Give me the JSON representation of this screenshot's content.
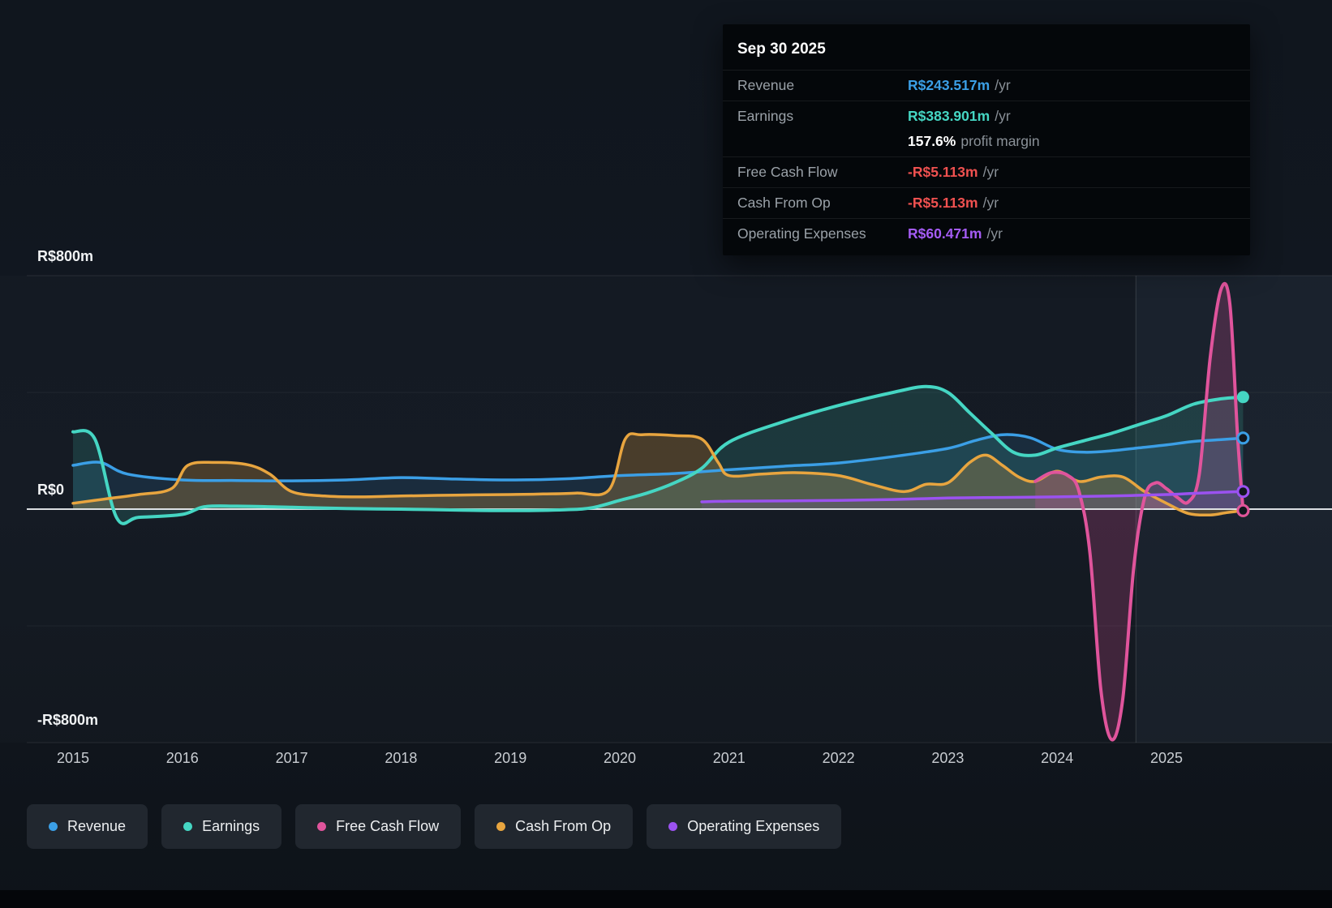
{
  "tooltip": {
    "date": "Sep 30 2025",
    "rows": [
      {
        "label": "Revenue",
        "value": "R$243.517m",
        "suffix": "/yr",
        "color": "#3b9fe6"
      },
      {
        "label": "Earnings",
        "value": "R$383.901m",
        "suffix": "/yr",
        "color": "#45d6c3"
      },
      {
        "label": "Free Cash Flow",
        "value": "-R$5.113m",
        "suffix": "/yr",
        "color": "#f05150"
      },
      {
        "label": "Cash From Op",
        "value": "-R$5.113m",
        "suffix": "/yr",
        "color": "#f05150"
      },
      {
        "label": "Operating Expenses",
        "value": "R$60.471m",
        "suffix": "/yr",
        "color": "#a55cf5"
      }
    ],
    "margin": {
      "value": "157.6%",
      "text": "profit margin"
    }
  },
  "axis": {
    "y_top": "R$800m",
    "y_zero": "R$0",
    "y_bottom": "-R$800m"
  },
  "legend": {
    "items": [
      {
        "label": "Revenue",
        "color": "#3b9fe6"
      },
      {
        "label": "Earnings",
        "color": "#45d6c3"
      },
      {
        "label": "Free Cash Flow",
        "color": "#e0549c"
      },
      {
        "label": "Cash From Op",
        "color": "#e8a53f"
      },
      {
        "label": "Operating Expenses",
        "color": "#9b52f0"
      }
    ]
  },
  "chart_data": {
    "type": "line",
    "x_unit": "year",
    "ylim": [
      -800,
      800
    ],
    "grid": true,
    "legend_position": "bottom",
    "y_tick_labels": [
      "R$800m",
      "R$0",
      "-R$800m"
    ],
    "x_tick_labels": [
      "2015",
      "2016",
      "2017",
      "2018",
      "2019",
      "2020",
      "2021",
      "2022",
      "2023",
      "2024",
      "2025"
    ],
    "highlight_band_start": 2024.72,
    "series": [
      {
        "name": "Revenue",
        "color": "#3b9fe6",
        "fill_opacity": 0.13,
        "width": 3.5,
        "x": [
          2015,
          2015.25,
          2015.5,
          2016,
          2016.5,
          2017,
          2017.5,
          2018,
          2018.5,
          2019,
          2019.5,
          2020,
          2020.5,
          2021,
          2021.5,
          2022,
          2022.5,
          2023,
          2023.25,
          2023.5,
          2023.75,
          2024,
          2024.25,
          2024.5,
          2024.75,
          2025,
          2025.25,
          2025.5,
          2025.7
        ],
        "values": [
          150,
          160,
          120,
          100,
          98,
          97,
          100,
          108,
          103,
          100,
          104,
          115,
          122,
          135,
          147,
          158,
          180,
          208,
          235,
          255,
          245,
          205,
          195,
          200,
          210,
          220,
          232,
          238,
          243.5
        ]
      },
      {
        "name": "Earnings",
        "color": "#45d6c3",
        "fill_opacity": 0.16,
        "width": 4,
        "x": [
          2015,
          2015.2,
          2015.4,
          2015.6,
          2016,
          2016.2,
          2016.5,
          2017,
          2017.5,
          2018,
          2018.5,
          2019,
          2019.5,
          2019.75,
          2020,
          2020.25,
          2020.5,
          2020.75,
          2021,
          2021.5,
          2022,
          2022.5,
          2022.8,
          2023,
          2023.2,
          2023.4,
          2023.6,
          2023.8,
          2024,
          2024.25,
          2024.5,
          2024.75,
          2025,
          2025.25,
          2025.5,
          2025.7
        ],
        "values": [
          265,
          240,
          -30,
          -28,
          -18,
          8,
          10,
          6,
          2,
          0,
          -3,
          -5,
          -2,
          5,
          30,
          55,
          90,
          140,
          230,
          300,
          355,
          400,
          420,
          400,
          330,
          260,
          195,
          185,
          210,
          235,
          260,
          290,
          320,
          360,
          378,
          383.9
        ]
      },
      {
        "name": "Cash From Op",
        "color": "#e8a53f",
        "fill_opacity": 0.25,
        "width": 3.5,
        "x": [
          2015,
          2015.3,
          2015.6,
          2015.9,
          2016.05,
          2016.3,
          2016.6,
          2016.8,
          2017,
          2017.3,
          2017.6,
          2018,
          2018.5,
          2019,
          2019.3,
          2019.6,
          2019.9,
          2020.05,
          2020.2,
          2020.5,
          2020.75,
          2020.9,
          2021,
          2021.3,
          2021.6,
          2022,
          2022.3,
          2022.6,
          2022.8,
          2023,
          2023.2,
          2023.35,
          2023.5,
          2023.65,
          2023.8,
          2024,
          2024.2,
          2024.4,
          2024.6,
          2024.8,
          2025,
          2025.2,
          2025.4,
          2025.55,
          2025.7
        ],
        "values": [
          20,
          35,
          50,
          70,
          150,
          160,
          152,
          120,
          60,
          45,
          42,
          45,
          48,
          50,
          52,
          55,
          65,
          240,
          255,
          252,
          240,
          160,
          115,
          120,
          125,
          115,
          85,
          60,
          85,
          90,
          160,
          185,
          150,
          110,
          95,
          130,
          95,
          110,
          110,
          60,
          20,
          -15,
          -20,
          -12,
          -5.1
        ]
      },
      {
        "name": "Free Cash Flow",
        "color": "#e0549c",
        "fill_opacity": 0.22,
        "width": 4,
        "x": [
          2023.8,
          2023.95,
          2024.1,
          2024.2,
          2024.3,
          2024.4,
          2024.5,
          2024.6,
          2024.7,
          2024.8,
          2024.9,
          2025,
          2025.1,
          2025.2,
          2025.3,
          2025.4,
          2025.5,
          2025.58,
          2025.65,
          2025.7
        ],
        "values": [
          95,
          125,
          115,
          60,
          -150,
          -620,
          -790,
          -650,
          -200,
          40,
          90,
          70,
          40,
          25,
          120,
          520,
          755,
          700,
          250,
          -5.1
        ]
      },
      {
        "name": "Operating Expenses",
        "color": "#9b52f0",
        "fill_opacity": 0.12,
        "width": 3.5,
        "x": [
          2020.75,
          2021,
          2021.5,
          2022,
          2022.5,
          2023,
          2023.5,
          2024,
          2024.5,
          2025,
          2025.3,
          2025.7
        ],
        "values": [
          25,
          27,
          28,
          30,
          33,
          38,
          40,
          42,
          45,
          50,
          55,
          60.5
        ]
      }
    ]
  }
}
